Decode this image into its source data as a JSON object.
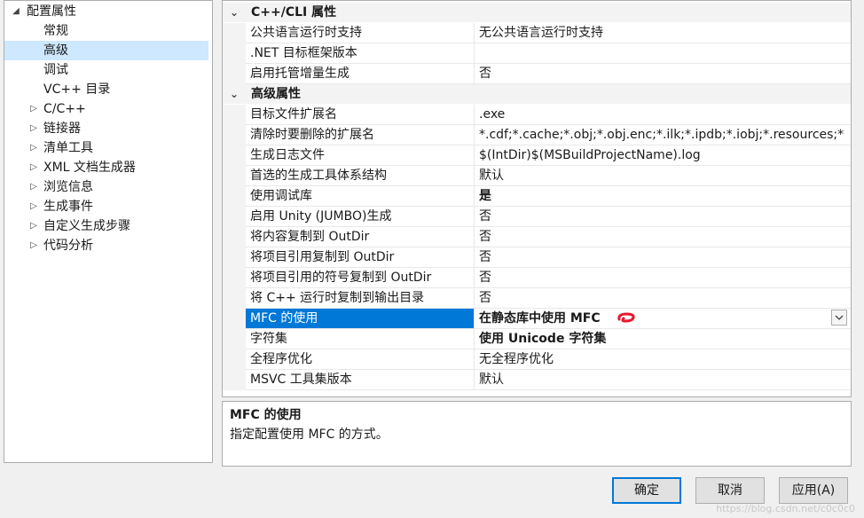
{
  "tree": {
    "root_label": "配置属性",
    "items": [
      "常规",
      "高级",
      "调试",
      "VC++ 目录",
      "C/C++",
      "链接器",
      "清单工具",
      "XML 文档生成器",
      "浏览信息",
      "生成事件",
      "自定义生成步骤",
      "代码分析"
    ]
  },
  "grid": {
    "categories": [
      "C++/CLI 属性",
      "高级属性"
    ],
    "cli_props": [
      {
        "name": "公共语言运行时支持",
        "value": "无公共语言运行时支持"
      },
      {
        "name": ".NET 目标框架版本",
        "value": ""
      },
      {
        "name": "启用托管增量生成",
        "value": "否"
      }
    ],
    "advanced_props": [
      {
        "name": "目标文件扩展名",
        "value": ".exe"
      },
      {
        "name": "清除时要删除的扩展名",
        "value": "*.cdf;*.cache;*.obj;*.obj.enc;*.ilk;*.ipdb;*.iobj;*.resources;*"
      },
      {
        "name": "生成日志文件",
        "value": "$(IntDir)$(MSBuildProjectName).log"
      },
      {
        "name": "首选的生成工具体系结构",
        "value": "默认"
      },
      {
        "name": "使用调试库",
        "value": "是"
      },
      {
        "name": "启用 Unity (JUMBO)生成",
        "value": "否"
      },
      {
        "name": "将内容复制到 OutDir",
        "value": "否"
      },
      {
        "name": "将项目引用复制到 OutDir",
        "value": "否"
      },
      {
        "name": "将项目引用的符号复制到 OutDir",
        "value": "否"
      },
      {
        "name": "将 C++ 运行时复制到输出目录",
        "value": "否"
      },
      {
        "name": "MFC 的使用",
        "value": "在静态库中使用 MFC"
      },
      {
        "name": "字符集",
        "value": "使用 Unicode 字符集"
      },
      {
        "name": "全程序优化",
        "value": "无全程序优化"
      },
      {
        "name": "MSVC 工具集版本",
        "value": "默认"
      }
    ]
  },
  "description": {
    "title": "MFC 的使用",
    "text": "指定配置使用 MFC 的方式。"
  },
  "buttons": {
    "ok": "确定",
    "cancel": "取消",
    "apply": "应用(A)"
  },
  "watermark": "https://blog.csdn.net/c0c0c0",
  "colors": {
    "selection": "#0078d7",
    "tree_selected": "#cde8ff",
    "mark": "#e8192c"
  }
}
